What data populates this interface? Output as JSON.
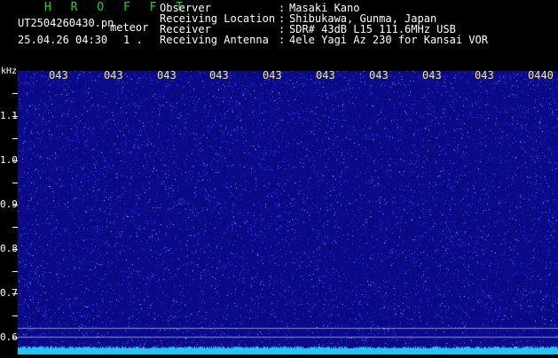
{
  "header": {
    "app_title": "H R O F F T",
    "filename": "UT2504260430.pn",
    "mode": "meteor",
    "datetime": "25.04.26 04:30",
    "page": "1 .",
    "fields": [
      {
        "label": "Observer",
        "sep": ":",
        "value": "Masaki Kano"
      },
      {
        "label": "Receiving Location",
        "sep": ":",
        "value": "Shibukawa, Gunma, Japan"
      },
      {
        "label": "Receiver",
        "sep": ":",
        "value": "SDR# 43dB L15 111.6MHz USB"
      },
      {
        "label": "Receiving Antenna",
        "sep": ":",
        "value": "4ele Yagi Az 230 for Kansai VOR"
      }
    ]
  },
  "spectrogram": {
    "unit_label": "kHz",
    "time_labels": [
      "043",
      "043",
      "043",
      "043",
      "043",
      "043",
      "043",
      "043",
      "043",
      "0440"
    ],
    "freq_labels": [
      "1.1",
      "1.0",
      "0.9",
      "0.8",
      "0.7",
      "0.6"
    ],
    "background_color": "#0a0a86",
    "noise_color": "#4a4aff",
    "band_color": "#1ec8f0",
    "time_label_color": "#f4f45a",
    "title_color": "#1fd41f"
  }
}
